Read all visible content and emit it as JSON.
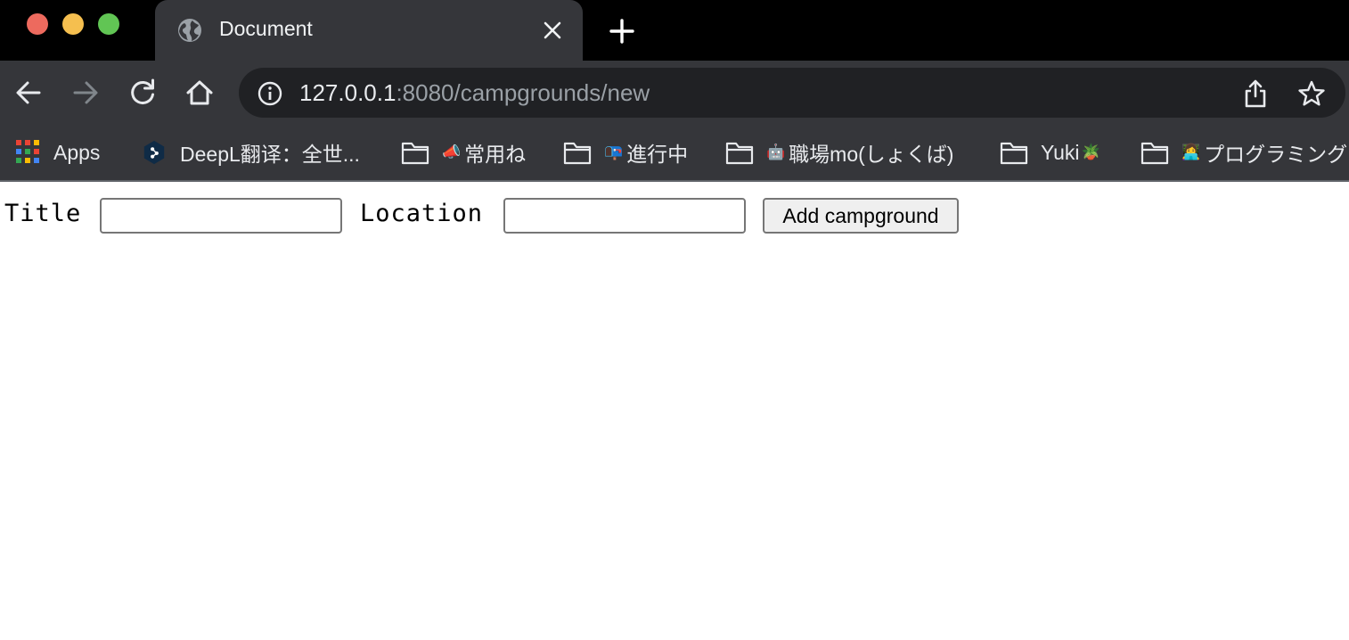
{
  "browser": {
    "window_controls": [
      "close",
      "minimize",
      "maximize"
    ],
    "tab": {
      "title": "Document",
      "icon": "globe-icon"
    },
    "address_bar": {
      "host": "127.0.0.1",
      "path": ":8080/campgrounds/new"
    },
    "bookmarks": [
      {
        "label": "Apps",
        "icon": "apps-grid-icon"
      },
      {
        "label": "DeepL翻译：全世...",
        "icon": "deepl-icon"
      },
      {
        "emoji": "📣",
        "label": "常用ね",
        "icon": "folder-icon"
      },
      {
        "emoji": "📭",
        "label": "進行中",
        "icon": "folder-icon"
      },
      {
        "emoji": "🤖",
        "label": "職場mo(しょくば)",
        "icon": "folder-icon"
      },
      {
        "label": "Yuki",
        "emoji_after": "🪴",
        "icon": "folder-icon"
      },
      {
        "emoji": "👩‍💻",
        "label": "プログラミング",
        "icon": "folder-icon"
      }
    ]
  },
  "form": {
    "title_label": "Title",
    "title_value": "",
    "location_label": "Location",
    "location_value": "",
    "submit_label": "Add campground"
  },
  "colors": {
    "titlebar": "#000000",
    "chrome": "#35363a",
    "omnibox": "#202124",
    "close": "#ed6a5e",
    "minimize": "#f5bf4f",
    "maximize": "#61c554"
  }
}
